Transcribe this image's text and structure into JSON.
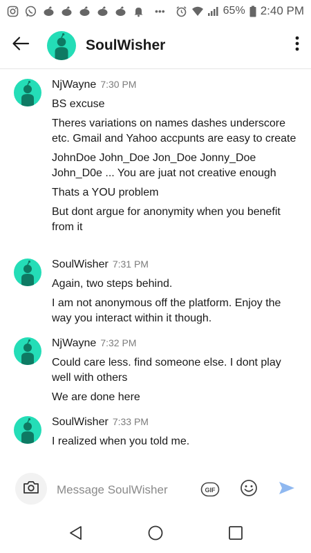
{
  "status_bar": {
    "battery": "65%",
    "time": "2:40 PM",
    "more": "•••"
  },
  "header": {
    "back_icon": "arrow-left-icon",
    "title": "SoulWisher",
    "menu_icon": "kebab-menu-icon"
  },
  "messages": [
    {
      "username": "NjWayne",
      "time": "7:30 PM",
      "lines": [
        "BS excuse",
        "Theres variations on names dashes underscore etc. Gmail and Yahoo accpunts are easy to create",
        "JohnDoe John_Doe Jon_Doe Jonny_Doe John_D0e ... You are juat not creative enough",
        "Thats a YOU problem",
        "But dont argue for anonymity when you benefit from it"
      ]
    },
    {
      "username": "SoulWisher",
      "time": "7:31 PM",
      "lines": [
        "Again, two steps behind.",
        "I am not anonymous off the platform. Enjoy the way you interact within it though."
      ]
    },
    {
      "username": "NjWayne",
      "time": "7:32 PM",
      "lines": [
        "Could care less. find someone else. I dont play well with others",
        "We are done here"
      ]
    },
    {
      "username": "SoulWisher",
      "time": "7:33 PM",
      "lines": [
        "I realized when you told me."
      ]
    }
  ],
  "composer": {
    "placeholder": "Message SoulWisher",
    "gif_label": "GIF"
  },
  "colors": {
    "avatar_bg": "#24ddb7",
    "send_icon": "#8fb8f0"
  }
}
